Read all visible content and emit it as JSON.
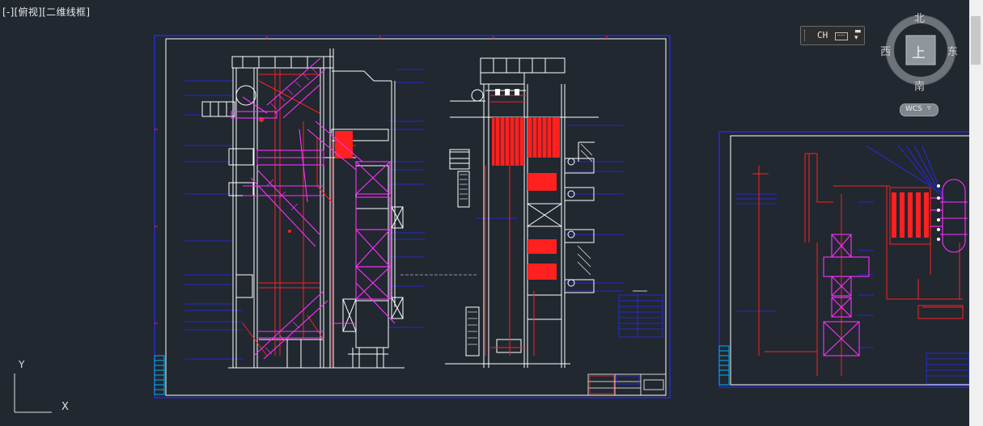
{
  "viewport": {
    "label": "[-][俯视][二维线框]"
  },
  "viewcube": {
    "north": "北",
    "south": "南",
    "east": "东",
    "west": "西",
    "face": "上",
    "wcs_label": "WCS"
  },
  "ime": {
    "language": "CH"
  },
  "ucs": {
    "x_label": "X",
    "y_label": "Y"
  },
  "colors": {
    "background": "#212830",
    "border_blue": "#1a1aff",
    "line_white": "#ffffff",
    "line_red": "#ff2020",
    "line_magenta": "#ff30ff"
  }
}
